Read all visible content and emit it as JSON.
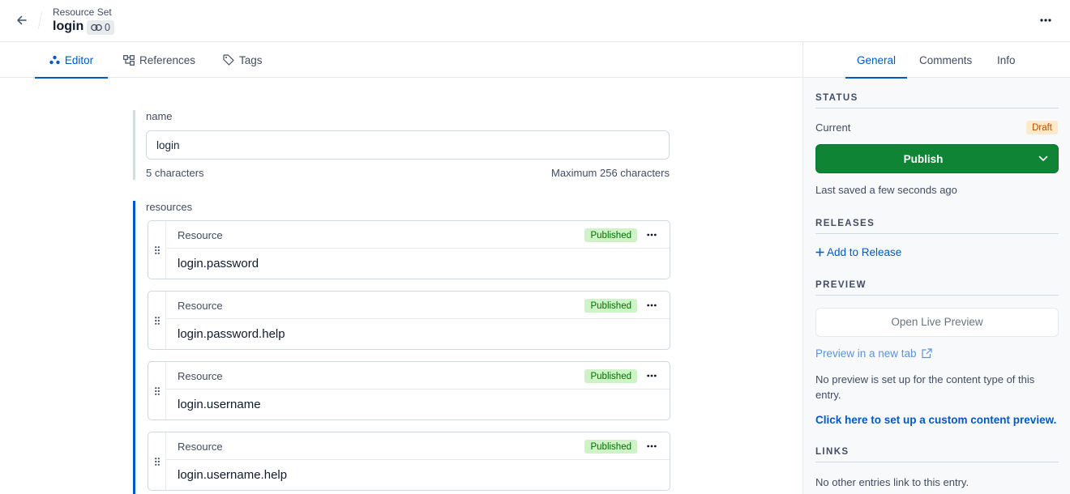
{
  "header": {
    "entry_type": "Resource Set",
    "entry_title": "login",
    "reference_count": "0"
  },
  "tabs": [
    {
      "label": "Editor",
      "icon": "editor-icon"
    },
    {
      "label": "References",
      "icon": "references-icon"
    },
    {
      "label": "Tags",
      "icon": "tag-icon"
    }
  ],
  "fields": {
    "name": {
      "label": "name",
      "value": "login",
      "char_count": "5 characters",
      "char_max": "Maximum 256 characters"
    },
    "resources": {
      "label": "resources",
      "items": [
        {
          "type": "Resource",
          "status": "Published",
          "title": "login.password"
        },
        {
          "type": "Resource",
          "status": "Published",
          "title": "login.password.help"
        },
        {
          "type": "Resource",
          "status": "Published",
          "title": "login.username"
        },
        {
          "type": "Resource",
          "status": "Published",
          "title": "login.username.help"
        }
      ]
    }
  },
  "sidebar": {
    "tabs": [
      "General",
      "Comments",
      "Info"
    ],
    "status": {
      "heading": "STATUS",
      "current_label": "Current",
      "current_badge": "Draft",
      "publish_label": "Publish",
      "last_saved": "Last saved a few seconds ago"
    },
    "releases": {
      "heading": "RELEASES",
      "add_label": "Add to Release"
    },
    "preview": {
      "heading": "PREVIEW",
      "open_live_label": "Open Live Preview",
      "new_tab_label": "Preview in a new tab",
      "no_preview_text": "No preview is set up for the content type of this entry.",
      "custom_link": "Click here to set up a custom content preview."
    },
    "links": {
      "heading": "LINKS",
      "text": "No other entries link to this entry."
    }
  },
  "colors": {
    "accent": "#0059c8",
    "publish": "#0f8435",
    "published_badge_bg": "#cdf3c6",
    "draft_badge_bg": "#feeacb"
  }
}
